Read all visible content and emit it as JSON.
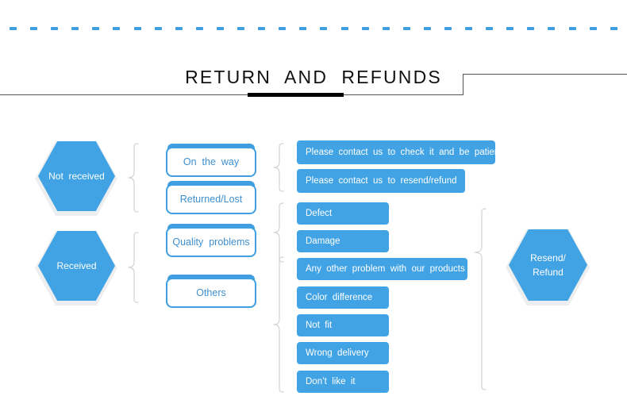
{
  "page": {
    "title": "RETURN  AND  REFUNDS",
    "accent_color": "#41a3e3",
    "outline_text_color": "#3d8fd0",
    "rule_color": "#555555",
    "dash_color": "#3d9ee0",
    "dash_count": 30
  },
  "stages": {
    "not_received": {
      "label": "Not  received"
    },
    "received": {
      "label": "Received"
    },
    "resolution": {
      "label": "Resend/\nRefund"
    }
  },
  "categories": [
    {
      "id": "on-the-way",
      "label": "On  the  way"
    },
    {
      "id": "returned-lost",
      "label": "Returned/Lost"
    },
    {
      "id": "quality-problems",
      "label": "Quality  problems"
    },
    {
      "id": "others",
      "label": "Others"
    }
  ],
  "actions": [
    {
      "id": "contact-check",
      "label": "Please  contact  us  to  check  it  and  be  patient"
    },
    {
      "id": "contact-resend",
      "label": "Please  contact  us  to  resend/refund"
    },
    {
      "id": "defect",
      "label": "Defect"
    },
    {
      "id": "damage",
      "label": "Damage"
    },
    {
      "id": "any-other-problem",
      "label": "Any  other  problem  with  our  products"
    },
    {
      "id": "color-difference",
      "label": "Color  difference"
    },
    {
      "id": "not-fit",
      "label": "Not  fit"
    },
    {
      "id": "wrong-delivery",
      "label": "Wrong  delivery"
    },
    {
      "id": "dont-like-it",
      "label": "Don’t  like  it"
    }
  ]
}
